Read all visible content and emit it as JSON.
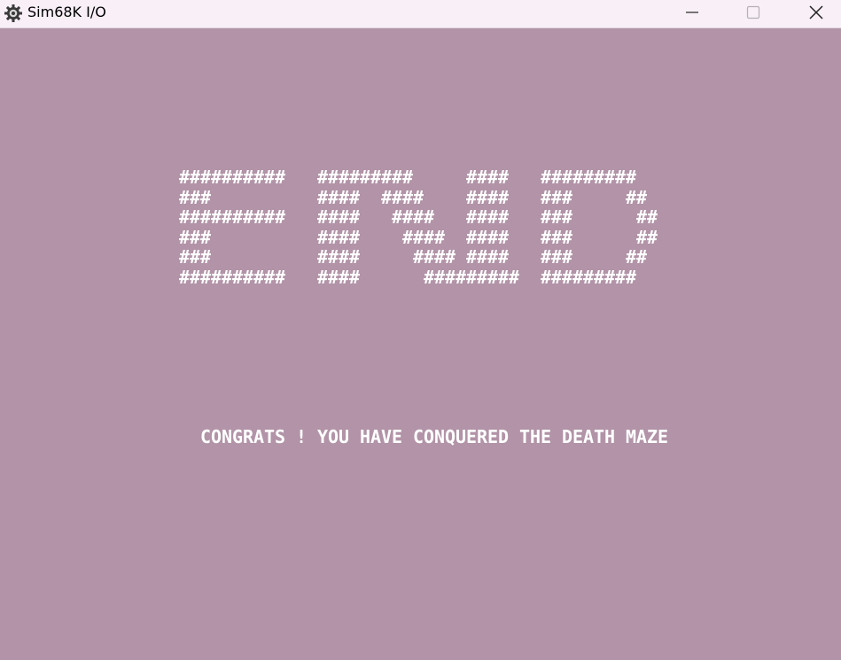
{
  "window": {
    "title": "Sim68K I/O",
    "icon": "gear-icon",
    "controls": {
      "minimize": "minimize-icon",
      "maximize": "maximize-icon",
      "close": "close-icon"
    }
  },
  "screen": {
    "background": "#b293a7",
    "text_color": "#ffffff",
    "end_art": [
      "##########   #########     ####   #########",
      "###          ####  ####    ####   ###     ##",
      "##########   ####   ####   ####   ###      ##",
      "###          ####    ####  ####   ###      ##",
      "###          ####     #### ####   ###     ##",
      "##########   ####      #########  #########"
    ],
    "message": "CONGRATS ! YOU HAVE CONQUERED THE DEATH MAZE"
  }
}
